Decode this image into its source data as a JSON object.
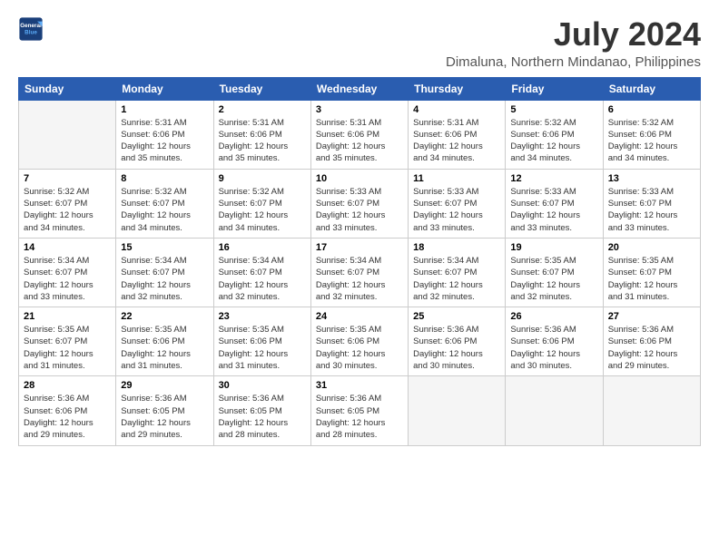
{
  "logo": {
    "line1": "General",
    "line2": "Blue"
  },
  "title": "July 2024",
  "subtitle": "Dimaluna, Northern Mindanao, Philippines",
  "days_header": [
    "Sunday",
    "Monday",
    "Tuesday",
    "Wednesday",
    "Thursday",
    "Friday",
    "Saturday"
  ],
  "weeks": [
    [
      {
        "num": "",
        "detail": ""
      },
      {
        "num": "1",
        "detail": "Sunrise: 5:31 AM\nSunset: 6:06 PM\nDaylight: 12 hours\nand 35 minutes."
      },
      {
        "num": "2",
        "detail": "Sunrise: 5:31 AM\nSunset: 6:06 PM\nDaylight: 12 hours\nand 35 minutes."
      },
      {
        "num": "3",
        "detail": "Sunrise: 5:31 AM\nSunset: 6:06 PM\nDaylight: 12 hours\nand 35 minutes."
      },
      {
        "num": "4",
        "detail": "Sunrise: 5:31 AM\nSunset: 6:06 PM\nDaylight: 12 hours\nand 34 minutes."
      },
      {
        "num": "5",
        "detail": "Sunrise: 5:32 AM\nSunset: 6:06 PM\nDaylight: 12 hours\nand 34 minutes."
      },
      {
        "num": "6",
        "detail": "Sunrise: 5:32 AM\nSunset: 6:06 PM\nDaylight: 12 hours\nand 34 minutes."
      }
    ],
    [
      {
        "num": "7",
        "detail": "Sunrise: 5:32 AM\nSunset: 6:07 PM\nDaylight: 12 hours\nand 34 minutes."
      },
      {
        "num": "8",
        "detail": "Sunrise: 5:32 AM\nSunset: 6:07 PM\nDaylight: 12 hours\nand 34 minutes."
      },
      {
        "num": "9",
        "detail": "Sunrise: 5:32 AM\nSunset: 6:07 PM\nDaylight: 12 hours\nand 34 minutes."
      },
      {
        "num": "10",
        "detail": "Sunrise: 5:33 AM\nSunset: 6:07 PM\nDaylight: 12 hours\nand 33 minutes."
      },
      {
        "num": "11",
        "detail": "Sunrise: 5:33 AM\nSunset: 6:07 PM\nDaylight: 12 hours\nand 33 minutes."
      },
      {
        "num": "12",
        "detail": "Sunrise: 5:33 AM\nSunset: 6:07 PM\nDaylight: 12 hours\nand 33 minutes."
      },
      {
        "num": "13",
        "detail": "Sunrise: 5:33 AM\nSunset: 6:07 PM\nDaylight: 12 hours\nand 33 minutes."
      }
    ],
    [
      {
        "num": "14",
        "detail": "Sunrise: 5:34 AM\nSunset: 6:07 PM\nDaylight: 12 hours\nand 33 minutes."
      },
      {
        "num": "15",
        "detail": "Sunrise: 5:34 AM\nSunset: 6:07 PM\nDaylight: 12 hours\nand 32 minutes."
      },
      {
        "num": "16",
        "detail": "Sunrise: 5:34 AM\nSunset: 6:07 PM\nDaylight: 12 hours\nand 32 minutes."
      },
      {
        "num": "17",
        "detail": "Sunrise: 5:34 AM\nSunset: 6:07 PM\nDaylight: 12 hours\nand 32 minutes."
      },
      {
        "num": "18",
        "detail": "Sunrise: 5:34 AM\nSunset: 6:07 PM\nDaylight: 12 hours\nand 32 minutes."
      },
      {
        "num": "19",
        "detail": "Sunrise: 5:35 AM\nSunset: 6:07 PM\nDaylight: 12 hours\nand 32 minutes."
      },
      {
        "num": "20",
        "detail": "Sunrise: 5:35 AM\nSunset: 6:07 PM\nDaylight: 12 hours\nand 31 minutes."
      }
    ],
    [
      {
        "num": "21",
        "detail": "Sunrise: 5:35 AM\nSunset: 6:07 PM\nDaylight: 12 hours\nand 31 minutes."
      },
      {
        "num": "22",
        "detail": "Sunrise: 5:35 AM\nSunset: 6:06 PM\nDaylight: 12 hours\nand 31 minutes."
      },
      {
        "num": "23",
        "detail": "Sunrise: 5:35 AM\nSunset: 6:06 PM\nDaylight: 12 hours\nand 31 minutes."
      },
      {
        "num": "24",
        "detail": "Sunrise: 5:35 AM\nSunset: 6:06 PM\nDaylight: 12 hours\nand 30 minutes."
      },
      {
        "num": "25",
        "detail": "Sunrise: 5:36 AM\nSunset: 6:06 PM\nDaylight: 12 hours\nand 30 minutes."
      },
      {
        "num": "26",
        "detail": "Sunrise: 5:36 AM\nSunset: 6:06 PM\nDaylight: 12 hours\nand 30 minutes."
      },
      {
        "num": "27",
        "detail": "Sunrise: 5:36 AM\nSunset: 6:06 PM\nDaylight: 12 hours\nand 29 minutes."
      }
    ],
    [
      {
        "num": "28",
        "detail": "Sunrise: 5:36 AM\nSunset: 6:06 PM\nDaylight: 12 hours\nand 29 minutes."
      },
      {
        "num": "29",
        "detail": "Sunrise: 5:36 AM\nSunset: 6:05 PM\nDaylight: 12 hours\nand 29 minutes."
      },
      {
        "num": "30",
        "detail": "Sunrise: 5:36 AM\nSunset: 6:05 PM\nDaylight: 12 hours\nand 28 minutes."
      },
      {
        "num": "31",
        "detail": "Sunrise: 5:36 AM\nSunset: 6:05 PM\nDaylight: 12 hours\nand 28 minutes."
      },
      {
        "num": "",
        "detail": ""
      },
      {
        "num": "",
        "detail": ""
      },
      {
        "num": "",
        "detail": ""
      }
    ]
  ]
}
